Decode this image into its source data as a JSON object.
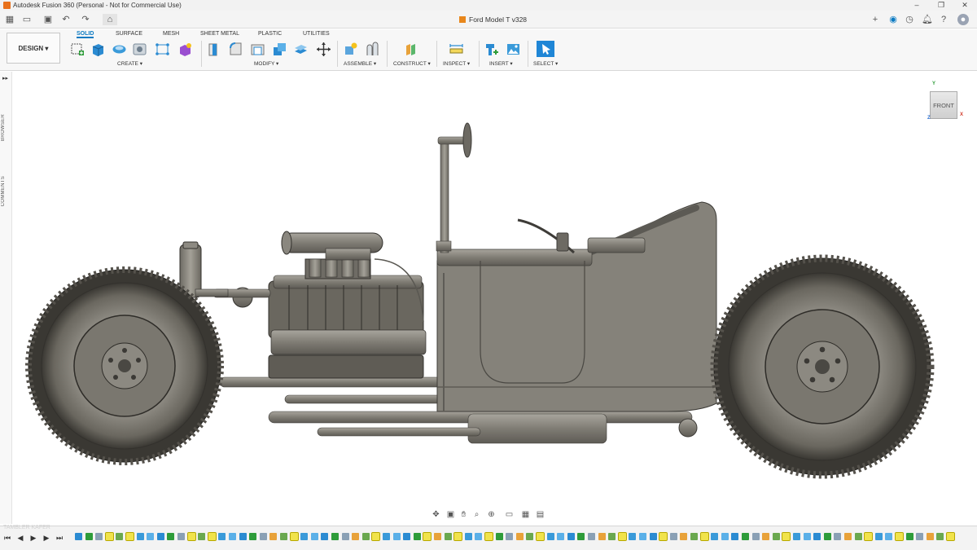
{
  "window": {
    "title": "Autodesk Fusion 360 (Personal - Not for Commercial Use)"
  },
  "document": {
    "tab_title": "Ford Model T v328"
  },
  "workspace": {
    "label": "DESIGN ▾"
  },
  "ribbon": {
    "tabs": [
      {
        "label": "SOLID",
        "active": true
      },
      {
        "label": "SURFACE",
        "active": false
      },
      {
        "label": "MESH",
        "active": false
      },
      {
        "label": "SHEET METAL",
        "active": false
      },
      {
        "label": "PLASTIC",
        "active": false
      },
      {
        "label": "UTILITIES",
        "active": false
      }
    ],
    "groups": [
      {
        "label": "CREATE ▾"
      },
      {
        "label": "MODIFY ▾"
      },
      {
        "label": "ASSEMBLE ▾"
      },
      {
        "label": "CONSTRUCT ▾"
      },
      {
        "label": "INSPECT ▾"
      },
      {
        "label": "INSERT ▾"
      },
      {
        "label": "SELECT ▾"
      }
    ]
  },
  "left_panel": {
    "browser_label": "BROWSER",
    "comments_label": "COMMENTS",
    "expand_glyph": "▸▸"
  },
  "viewcube": {
    "face_label": "FRONT",
    "axis_y": "Y",
    "axis_x": "X",
    "axis_z": "Z"
  },
  "watermark": {
    "text": "TAMBLER KAFER"
  },
  "colors": {
    "accent": "#0a7ac2",
    "brand_orange": "#e8711c",
    "body_gray": "#7d7a72",
    "highlight_yellow": "#f1e34b"
  },
  "icons": {
    "titlebar": [
      "fusion-app-icon"
    ],
    "qat": [
      "grid-icon",
      "file-icon",
      "save-icon",
      "undo-icon",
      "redo-icon",
      "home-icon"
    ],
    "right": [
      "new-tab-icon",
      "online-status-icon",
      "job-status-icon",
      "notifications-icon",
      "help-icon",
      "account-icon"
    ],
    "nav": [
      "orbit-icon",
      "look-at-icon",
      "pan-icon",
      "zoom-icon",
      "fit-icon",
      "display-settings-icon",
      "grid-settings-icon",
      "viewports-icon"
    ]
  }
}
